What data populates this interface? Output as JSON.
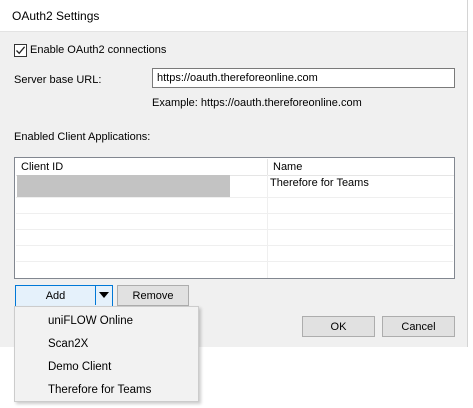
{
  "window": {
    "title": "OAuth2 Settings"
  },
  "enable_oauth": {
    "label": "Enable OAuth2 connections",
    "checked": true
  },
  "server_url": {
    "label": "Server base URL:",
    "value": "https://oauth.thereforeonline.com",
    "example": "Example: https://oauth.thereforeonline.com"
  },
  "clients": {
    "label": "Enabled Client Applications:",
    "columns": [
      "Client ID",
      "Name"
    ],
    "rows": [
      {
        "client_id": "",
        "name": "Therefore for Teams"
      }
    ]
  },
  "buttons": {
    "add": "Add",
    "remove": "Remove",
    "ok": "OK",
    "cancel": "Cancel"
  },
  "add_menu": {
    "items": [
      "uniFLOW Online",
      "Scan2X",
      "Demo Client",
      "Therefore for Teams"
    ]
  }
}
